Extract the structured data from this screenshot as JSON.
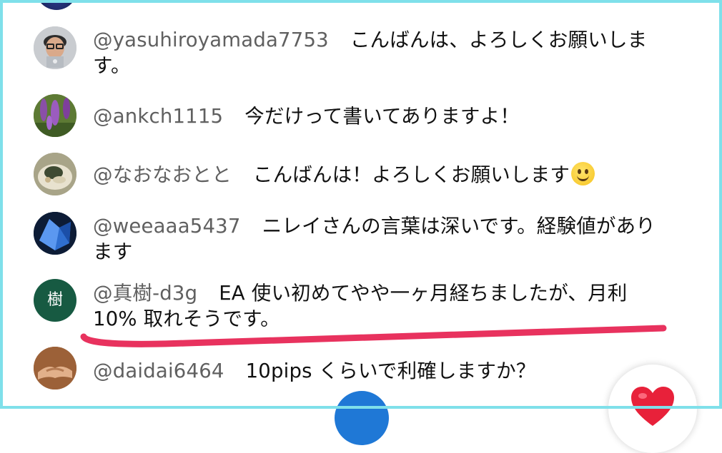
{
  "colors": {
    "frame": "#7fe0ea",
    "author_text": "#606060",
    "message_text": "#111111",
    "annotation_underline": "#e8325e",
    "like_heart": "#e8213a",
    "blue_button": "#1f78d6",
    "letter_avatar_bg": "#175a42"
  },
  "chat": {
    "messages": [
      {
        "author": "@yasuhiroyamada7753",
        "text": "こんばんは、よろしくお願いしま",
        "text_cont": "す。",
        "avatar": "person-with-glasses-avatar"
      },
      {
        "author": "@ankch1115",
        "text": "今だけって書いてありますよ！",
        "avatar": "purple-flowers-avatar"
      },
      {
        "author": "@なおなおとと",
        "text": "こんばんは！よろしくお願いします",
        "emoji": "smiling-face-emoji",
        "avatar": "food-photo-avatar"
      },
      {
        "author": "@weeaaa5437",
        "text": "ニレイさんの言葉は深いです。経験値があり",
        "text_cont": "ます",
        "avatar": "blue-crystal-avatar"
      },
      {
        "author": "@真樹-d3g",
        "text": "EA 使い初めてやや一ヶ月経ちましたが、月利",
        "text_cont": "10% 取れそうです。",
        "avatar_letter": "樹"
      },
      {
        "author": "@daidai6464",
        "text": "10pips くらいで利確しますか？",
        "avatar": "handshake-avatar"
      }
    ]
  },
  "controls": {
    "like_icon": "heart-icon",
    "blue_button_icon": "circle-button"
  }
}
